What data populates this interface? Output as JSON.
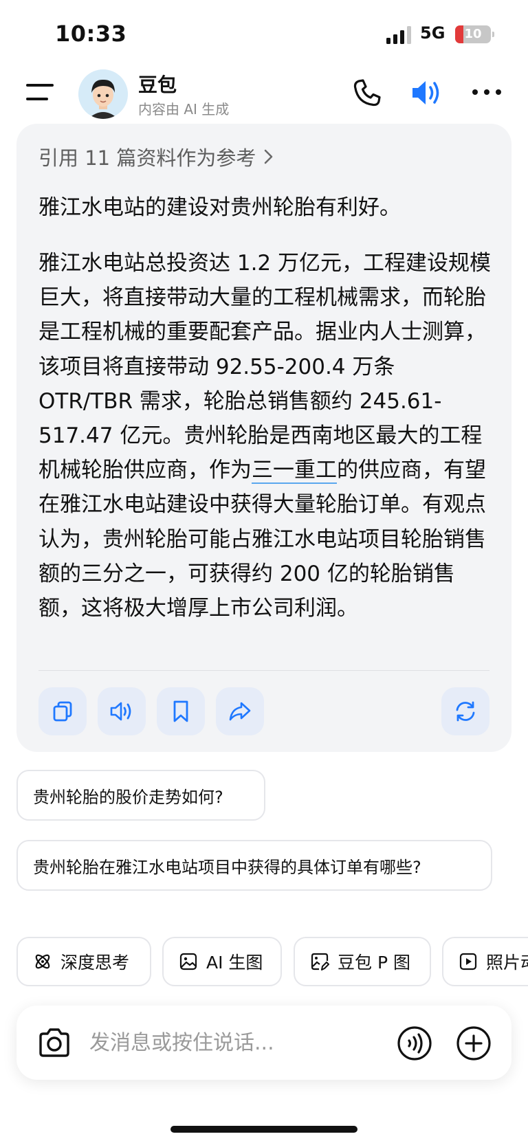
{
  "status_bar": {
    "time": "10:33",
    "network": "5G",
    "battery": "10"
  },
  "header": {
    "name": "豆包",
    "subtitle": "内容由 AI 生成"
  },
  "answer": {
    "references_link": "引用 11 篇资料作为参考",
    "lead": "雅江水电站的建设对贵州轮胎有利好。",
    "body_before": "雅江水电站总投资达 1.2 万亿元，工程建设规模巨大，将直接带动大量的工程机械需求，而轮胎是工程机械的重要配套产品。据业内人士测算，该项目将直接带动 92.55-200.4 万条 OTR/TBR 需求，轮胎总销售额约 245.61-517.47 亿元。贵州轮胎是西南地区最大的工程机械轮胎供应商，作为",
    "body_link": "三一重工",
    "body_after": "的供应商，有望在雅江水电站建设中获得大量轮胎订单。有观点认为，贵州轮胎可能占雅江水电站项目轮胎销售额的三分之一，可获得约 200 亿的轮胎销售额，这将极大增厚上市公司利润。"
  },
  "suggestions": [
    "贵州轮胎的股价走势如何?",
    "贵州轮胎在雅江水电站项目中获得的具体订单有哪些?"
  ],
  "tools": [
    {
      "label": "深度思考",
      "icon": "atom-icon"
    },
    {
      "label": "AI 生图",
      "icon": "image-icon"
    },
    {
      "label": "豆包 P 图",
      "icon": "image-edit-icon"
    },
    {
      "label": "照片动",
      "icon": "play-icon"
    }
  ],
  "input": {
    "placeholder": "发消息或按住说话..."
  },
  "colors": {
    "accent": "#1f78ff",
    "card_bg": "#f3f4f6",
    "action_bg": "#e6ecf8",
    "link_underline": "#5aa7ee"
  }
}
